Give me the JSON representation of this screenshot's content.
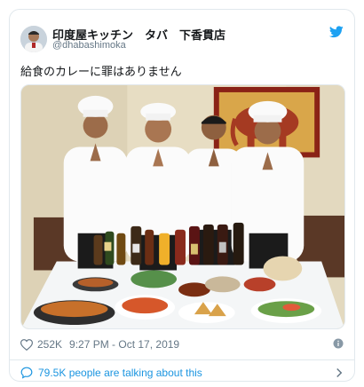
{
  "tweet": {
    "display_name": "印度屋キッチン　タバ　下香貫店",
    "handle": "@dhabashimoka",
    "text": "給食のカレーに罪はありません",
    "likes": "252K",
    "time": "9:27 PM - Oct 17, 2019",
    "talking": "79.5K people are talking about this"
  },
  "colors": {
    "accent": "#1da1f2",
    "link": "#1b95e0",
    "secondary_text": "#657786",
    "border": "#e1e8ed"
  },
  "icons": {
    "brand": "twitter-bird-icon",
    "like": "heart-icon",
    "info": "info-icon",
    "conversation": "speech-bubble-icon",
    "more": "chevron-right-icon"
  }
}
